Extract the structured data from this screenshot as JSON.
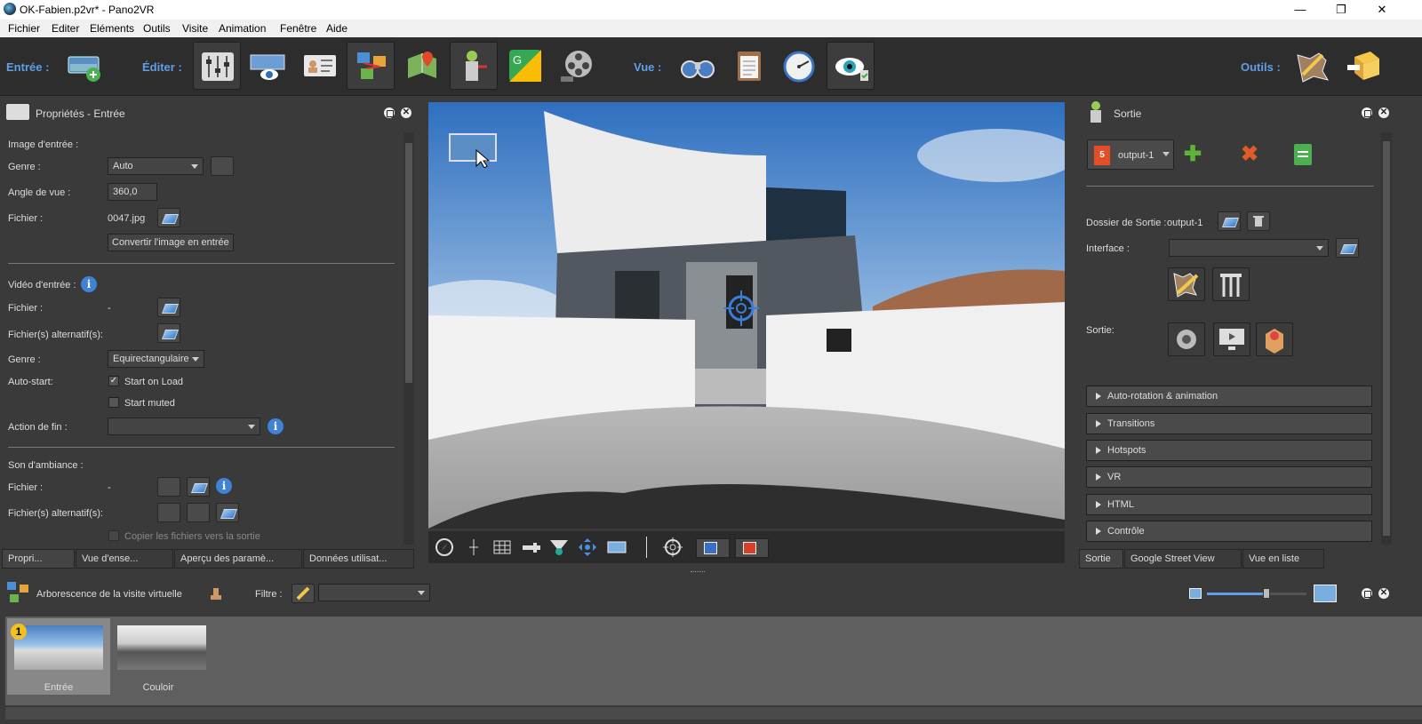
{
  "window": {
    "title": "OK-Fabien.p2vr* - Pano2VR",
    "minimize": "—",
    "restore": "❐",
    "close": "✕"
  },
  "menu": [
    "Fichier",
    "Editer",
    "Eléments",
    "Outils",
    "Visite",
    "Animation",
    "Fenêtre",
    "Aide"
  ],
  "toolbar": {
    "entree_label": "Entrée :",
    "editer_label": "Éditer :",
    "vue_label": "Vue :",
    "outils_label": "Outils :"
  },
  "left_panel": {
    "title": "Propriétés - Entrée",
    "image_section": "Image d'entrée :",
    "genre_label": "Genre :",
    "genre_value": "Auto",
    "angle_label": "Angle de vue :",
    "angle_value": "360,0",
    "fichier_label": "Fichier :",
    "fichier_value": "0047.jpg",
    "convert_button": "Convertir l'image en entrée",
    "video_section": "Vidéo d'entrée :",
    "video_fichier_label": "Fichier :",
    "video_fichier_value": "-",
    "video_alt_label": "Fichier(s) alternatif(s):",
    "video_genre_label": "Genre :",
    "video_genre_value": "Equirectangulaire",
    "autostart_label": "Auto-start:",
    "start_on_load": "Start on Load",
    "start_muted": "Start muted",
    "start_on_load_checked": true,
    "start_muted_checked": false,
    "action_fin_label": "Action de fin :",
    "action_fin_value": "",
    "son_section": "Son d'ambiance :",
    "son_fichier_label": "Fichier :",
    "son_fichier_value": "-",
    "son_alt_label": "Fichier(s) alternatif(s):",
    "copier_label": "Copier les fichiers vers la sortie"
  },
  "left_tabs": [
    "Propri...",
    "Vue d'ense...",
    "Aperçu des paramè...",
    "Données utilisat..."
  ],
  "right_panel": {
    "title": "Sortie",
    "output_select": "output-1",
    "dossier_label": "Dossier de Sortie :",
    "dossier_value": "output-1",
    "interface_label": "Interface :",
    "interface_value": "",
    "sortie_label": "Sortie:",
    "sections": [
      "Auto-rotation & animation",
      "Transitions",
      "Hotspots",
      "VR",
      "HTML",
      "Contrôle"
    ]
  },
  "right_tabs": [
    "Sortie",
    "Google Street View",
    "Vue en liste"
  ],
  "bottom": {
    "title": "Arborescence de la visite virtuelle",
    "filter_label": "Filtre :",
    "filter_value": "",
    "zoom_fraction": 0.6,
    "nodes": [
      {
        "label": "Entrée",
        "badge": "1"
      },
      {
        "label": "Couloir",
        "badge": ""
      }
    ]
  },
  "colors": {
    "accent": "#5f9ee8",
    "bg": "#3a3a3a",
    "toolbar": "#2d2d2d",
    "html5": "#e44d26",
    "plus": "#5fb336",
    "cross": "#e05a2a"
  },
  "icons": [
    "panorama-add-icon",
    "sliders-icon",
    "pano-eye-icon",
    "id-card-icon",
    "tour-map-icon",
    "map-pin-icon",
    "output-icon",
    "google-street-icon",
    "film-reel-icon",
    "binoculars-icon",
    "clipboard-icon",
    "gauge-icon",
    "eye-check-icon",
    "tour-tool-icon",
    "package-tool-icon"
  ]
}
